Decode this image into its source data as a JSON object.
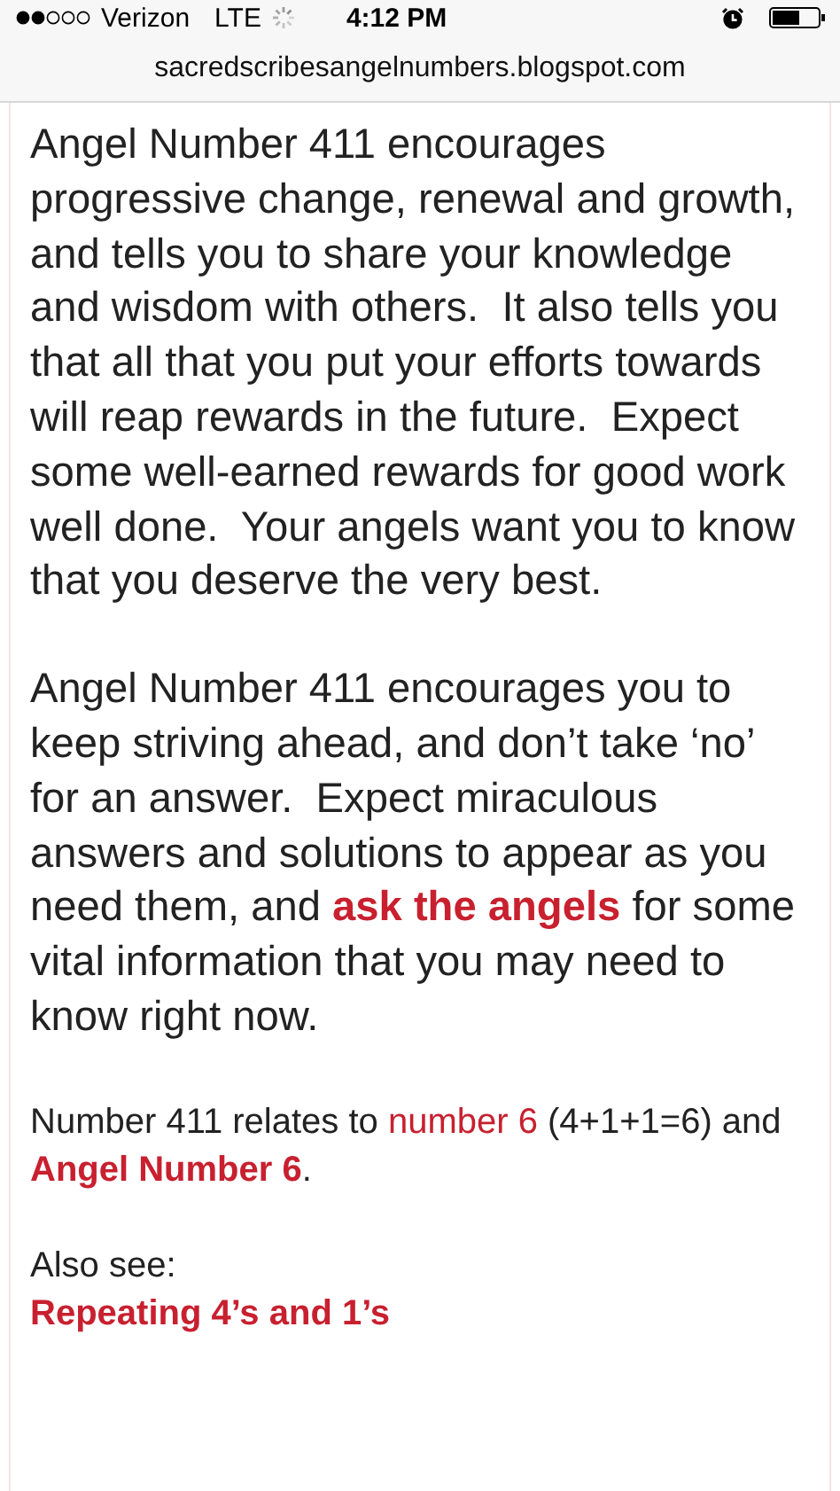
{
  "status_bar": {
    "carrier": "Verizon",
    "network": "LTE",
    "time": "4:12 PM"
  },
  "address_bar": {
    "url": "sacredscribesangelnumbers.blogspot.com"
  },
  "article": {
    "paragraphs": [
      [
        {
          "kind": "text",
          "text": "Angel Number 411 encourages progressive change, renewal and growth, and tells you to share your knowledge and wisdom with others.  It also tells you that all that you put your efforts towards will reap rewards in the future.  Expect some well-earned rewards for good work well done.  Your angels want you to know that you deserve the very best."
        }
      ],
      [
        {
          "kind": "text",
          "text": "Angel Number 411 encourages you to keep striving ahead, and don’t take ‘no’ for an answer.  Expect miraculous answers and solutions to appear as you need them, and "
        },
        {
          "kind": "bold-link",
          "text": "ask the angels"
        },
        {
          "kind": "text",
          "text": " for some vital information that you may need to know right now."
        }
      ],
      [
        {
          "kind": "text",
          "text": "Number 411 relates to "
        },
        {
          "kind": "link",
          "text": "number 6"
        },
        {
          "kind": "text",
          "text": " (4+1+1=6) and "
        },
        {
          "kind": "bold-link",
          "text": "Angel Number 6"
        },
        {
          "kind": "text",
          "text": "."
        }
      ]
    ],
    "also_see": {
      "label": "Also see:",
      "links": [
        "Repeating 4’s and 1’s"
      ]
    }
  }
}
